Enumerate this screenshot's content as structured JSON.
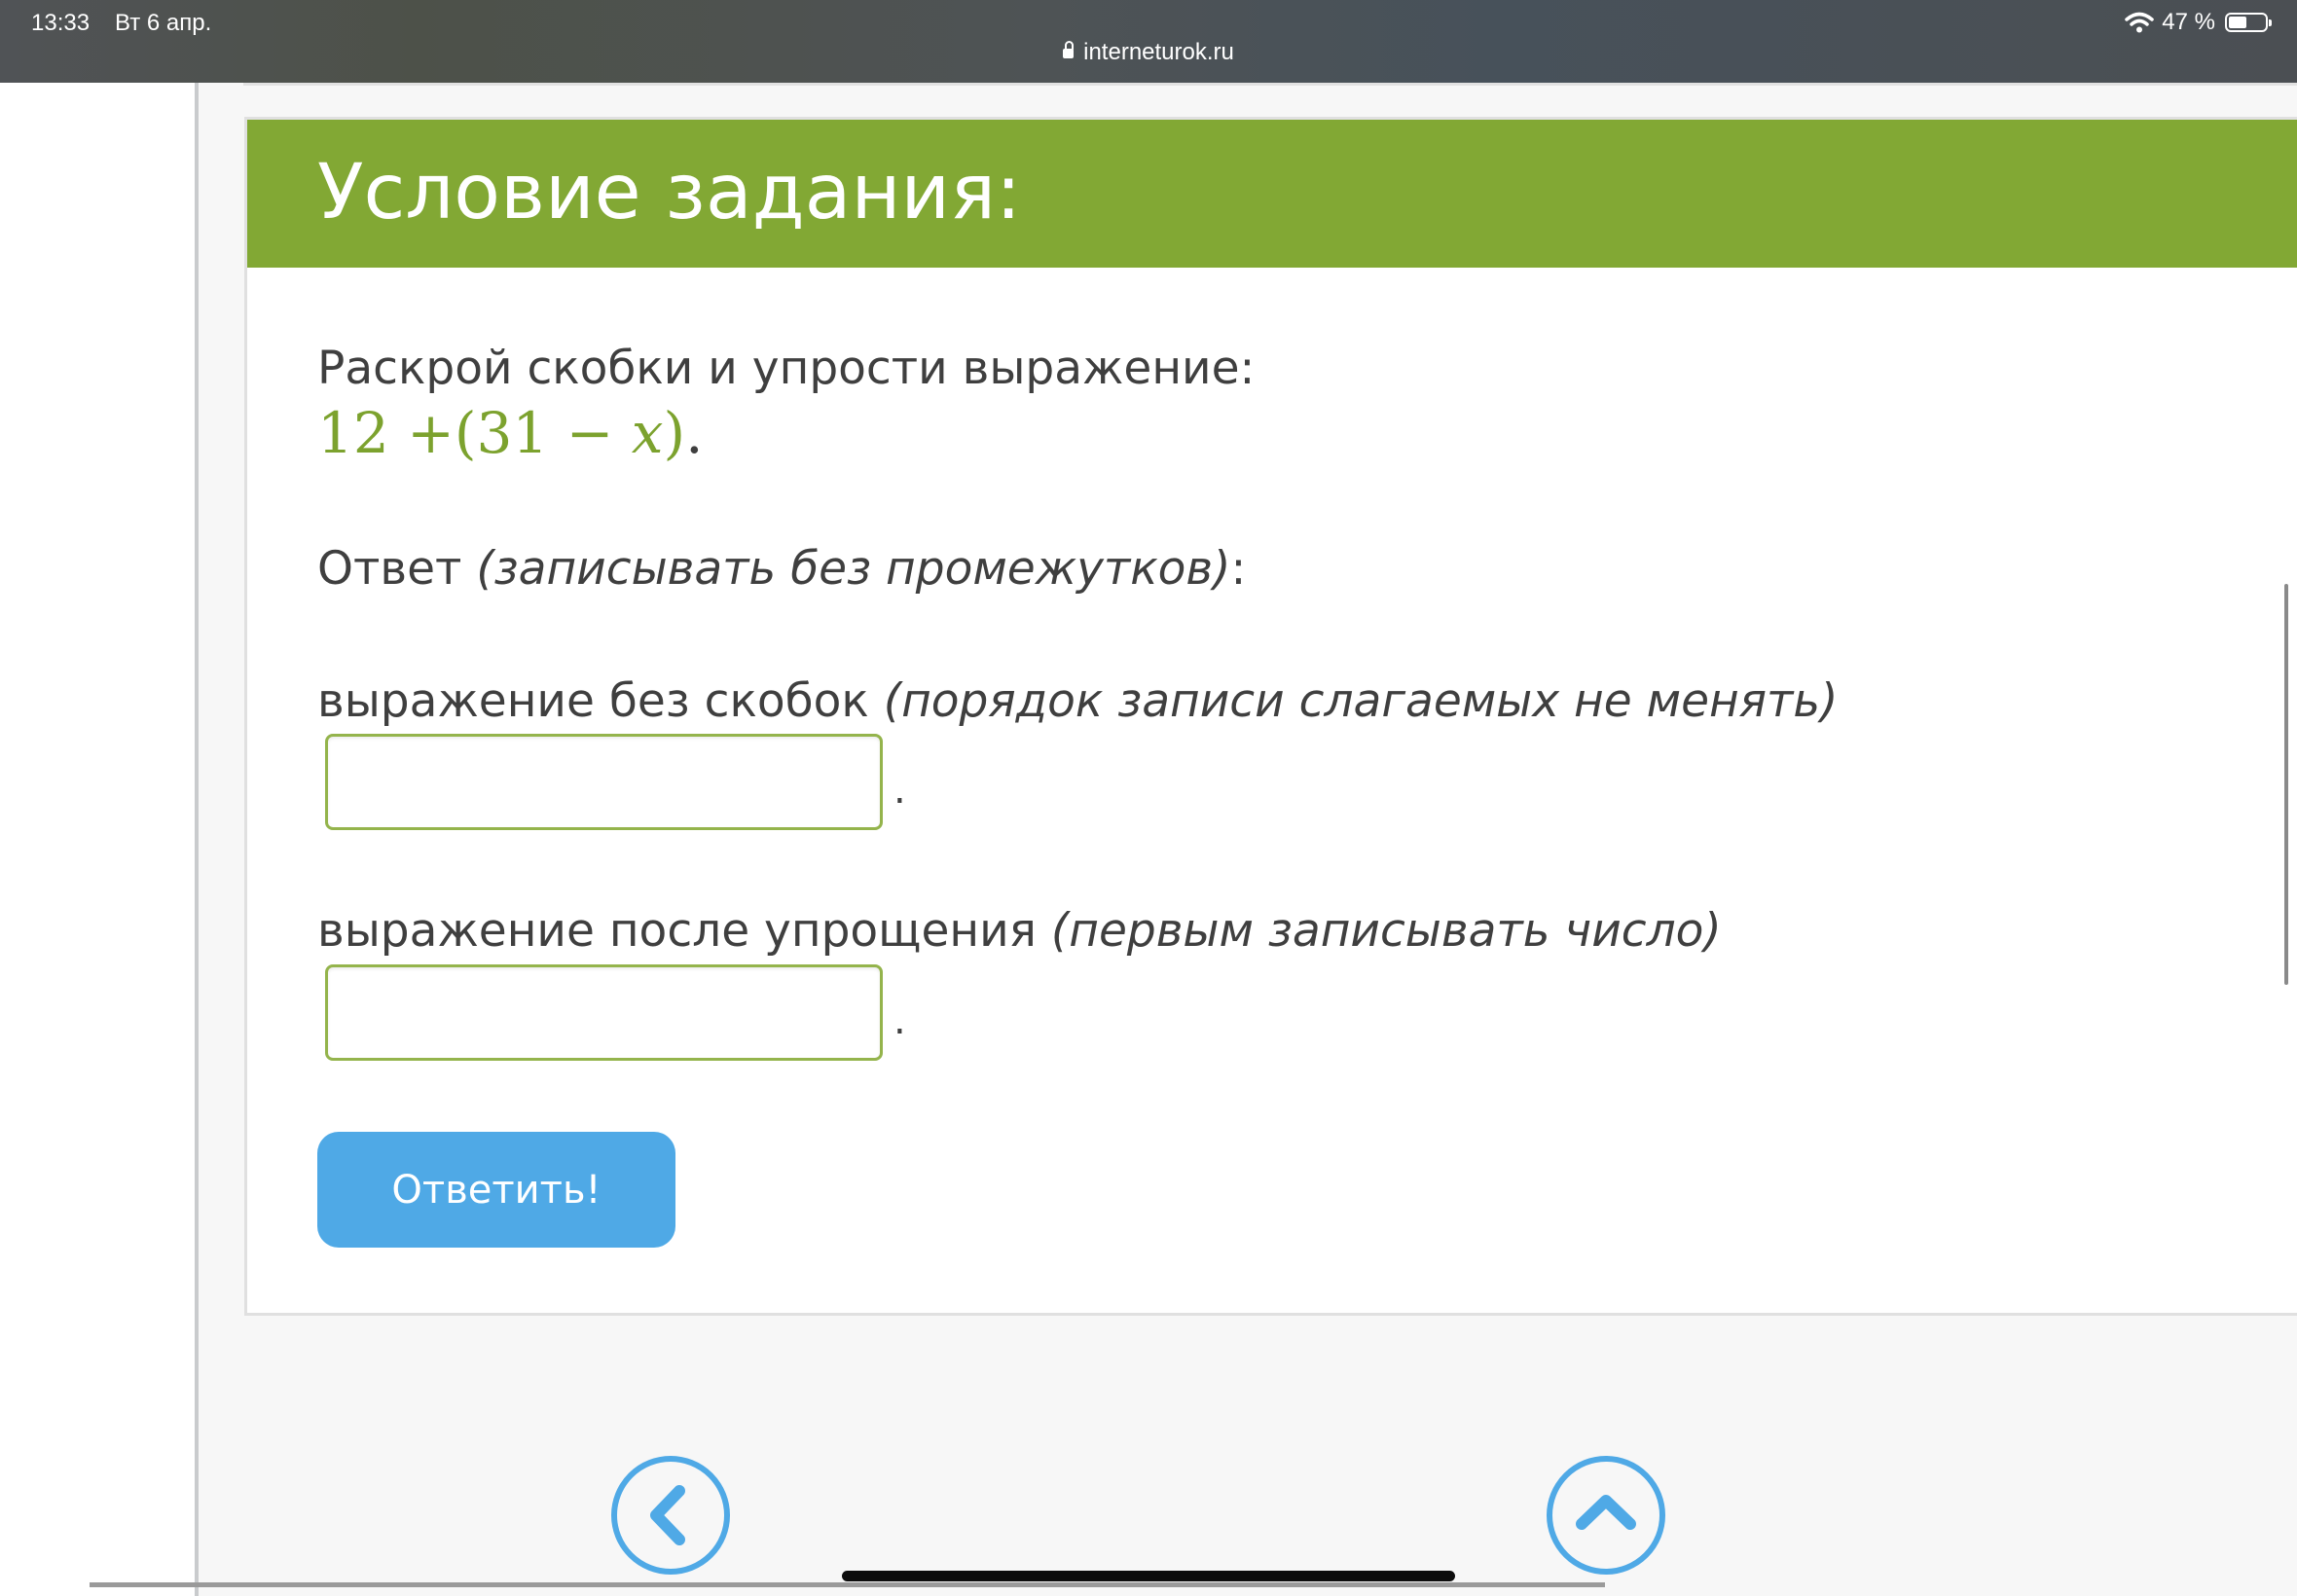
{
  "status_bar": {
    "time": "13:33",
    "date": "Вт 6 апр.",
    "url": "interneturok.ru",
    "battery": "47 %"
  },
  "task": {
    "title": "Условие задания:",
    "instruction": "Раскрой скобки и упрости выражение:",
    "formula": {
      "part1": "12 +(31 − ",
      "variable": "x",
      "part2": ")",
      "end": "."
    },
    "answer_label": "Ответ",
    "answer_note": "(записывать без промежутков)",
    "answer_colon": ":",
    "field1_label": "выражение без скобок",
    "field1_note": "(порядок записи слагаемых не менять)",
    "field1_value": "",
    "field1_period": ".",
    "field2_label": "выражение после упрощения",
    "field2_note": "(первым записывать число)",
    "field2_value": "",
    "field2_period": ".",
    "submit_label": "Ответить!"
  },
  "colors": {
    "header_green": "#82a834",
    "formula_green": "#7ca22e",
    "button_blue": "#4fa9e6"
  },
  "icons": {
    "back": "chevron-left-icon",
    "up": "chevron-up-icon"
  }
}
